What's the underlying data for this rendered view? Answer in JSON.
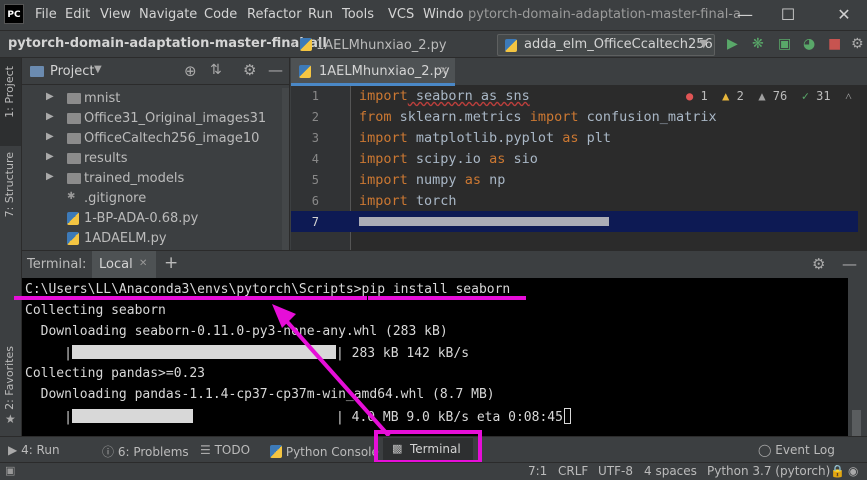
{
  "app": {
    "logo": "PC",
    "window_title": "pytorch-domain-adaptation-master-final-a"
  },
  "menu": [
    "File",
    "Edit",
    "View",
    "Navigate",
    "Code",
    "Refactor",
    "Run",
    "Tools",
    "VCS",
    "Windo"
  ],
  "nav": {
    "project": "pytorch-domain-adaptation-master-final-all",
    "file": "1AELMhunxiao_2.py",
    "run_config": "adda_elm_OfficeCcaltech256"
  },
  "left_strip": {
    "project_tab": "1: Project",
    "structure_tab": "7: Structure",
    "favorites_tab": "2: Favorites"
  },
  "project_panel": {
    "title": "Project",
    "items": [
      {
        "label": "mnist",
        "type": "folder"
      },
      {
        "label": "Office31_Original_images31",
        "type": "folder"
      },
      {
        "label": "OfficeCaltech256_image10",
        "type": "folder"
      },
      {
        "label": "results",
        "type": "folder"
      },
      {
        "label": "trained_models",
        "type": "folder"
      },
      {
        "label": ".gitignore",
        "type": "file"
      },
      {
        "label": "1-BP-ADA-0.68.py",
        "type": "py"
      },
      {
        "label": "1ADAELM.py",
        "type": "py"
      }
    ]
  },
  "editor": {
    "tab": "1AELMhunxiao_2.py",
    "inspections": {
      "errors": "1",
      "warnings": "2",
      "weak_warnings": "76",
      "ok": "31"
    },
    "lines": [
      {
        "no": "1",
        "kw1": "import",
        "rest": " seaborn as sns"
      },
      {
        "no": "2",
        "kw1": "from",
        "mid": " sklearn.metrics ",
        "kw2": "import",
        "rest": " confusion_matrix"
      },
      {
        "no": "3",
        "kw1": "import",
        "mid": " matplotlib.pyplot ",
        "kw2": "as",
        "rest": " plt"
      },
      {
        "no": "4",
        "kw1": "import",
        "mid": " scipy.io ",
        "kw2": "as",
        "rest": " sio"
      },
      {
        "no": "5",
        "kw1": "import",
        "mid": " numpy ",
        "kw2": "as",
        "rest": " np"
      },
      {
        "no": "6",
        "kw1": "import",
        "rest": " torch"
      },
      {
        "no": "7"
      }
    ]
  },
  "terminal": {
    "title": "Terminal:",
    "tab": "Local",
    "lines": {
      "prompt": "C:\\Users\\LL\\Anaconda3\\envs\\pytorch\\Scripts>",
      "command": "pip install seaborn",
      "l1": "Collecting seaborn",
      "l2": "  Downloading seaborn-0.11.0-py3-none-any.whl (283 kB)",
      "l3_stats": "| 283 kB 142 kB/s",
      "l4": "Collecting pandas>=0.23",
      "l5": "  Downloading pandas-1.1.4-cp37-cp37m-win_amd64.whl (8.7 MB)",
      "l6_stats": "| 4.0 MB 9.0 kB/s eta 0:08:45"
    },
    "progress": {
      "seaborn": 1.0,
      "pandas": 0.46
    }
  },
  "toolwindows": {
    "run": "4: Run",
    "problems": "6: Problems",
    "todo": "TODO",
    "python_console": "Python Console",
    "terminal": "Terminal",
    "event_log": "Event Log"
  },
  "status": {
    "position": "7:1",
    "line_sep": "CRLF",
    "encoding": "UTF-8",
    "indent": "4 spaces",
    "interpreter": "Python 3.7 (pytorch)"
  },
  "colors": {
    "annotation": "#e60ed8",
    "keyword": "#cc7832",
    "accent": "#4a88c7"
  }
}
